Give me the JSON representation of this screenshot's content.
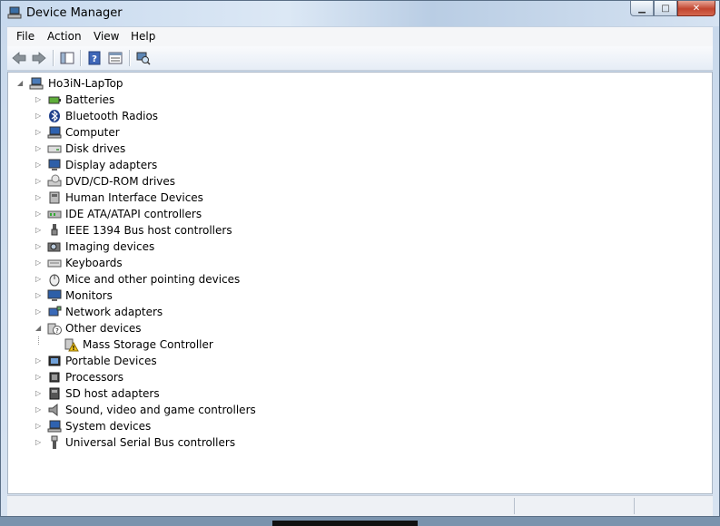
{
  "window": {
    "title": "Device Manager"
  },
  "menu": [
    "File",
    "Action",
    "View",
    "Help"
  ],
  "toolbar": {
    "buttons": [
      "back-icon",
      "forward-icon",
      "show-hide-tree-icon",
      "help-icon",
      "properties-icon",
      "scan-hardware-icon"
    ]
  },
  "tree": {
    "root": {
      "label": "Ho3iN-LapTop",
      "icon": "computer-root-icon"
    },
    "categories": [
      {
        "label": "Batteries",
        "icon": "battery-icon"
      },
      {
        "label": "Bluetooth Radios",
        "icon": "bluetooth-icon"
      },
      {
        "label": "Computer",
        "icon": "computer-icon"
      },
      {
        "label": "Disk drives",
        "icon": "disk-drive-icon"
      },
      {
        "label": "Display adapters",
        "icon": "display-adapter-icon"
      },
      {
        "label": "DVD/CD-ROM drives",
        "icon": "dvd-drive-icon"
      },
      {
        "label": "Human Interface Devices",
        "icon": "hid-icon"
      },
      {
        "label": "IDE ATA/ATAPI controllers",
        "icon": "ide-controller-icon"
      },
      {
        "label": "IEEE 1394 Bus host controllers",
        "icon": "ieee1394-icon"
      },
      {
        "label": "Imaging devices",
        "icon": "camera-icon"
      },
      {
        "label": "Keyboards",
        "icon": "keyboard-icon"
      },
      {
        "label": "Mice and other pointing devices",
        "icon": "mouse-icon"
      },
      {
        "label": "Monitors",
        "icon": "monitor-icon"
      },
      {
        "label": "Network adapters",
        "icon": "network-adapter-icon"
      },
      {
        "label": "Other devices",
        "icon": "unknown-device-icon",
        "expanded": true,
        "children": [
          {
            "label": "Mass Storage Controller",
            "icon": "warning-device-icon"
          }
        ]
      },
      {
        "label": "Portable Devices",
        "icon": "portable-device-icon"
      },
      {
        "label": "Processors",
        "icon": "processor-icon"
      },
      {
        "label": "SD host adapters",
        "icon": "sd-adapter-icon"
      },
      {
        "label": "Sound, video and game controllers",
        "icon": "speaker-icon"
      },
      {
        "label": "System devices",
        "icon": "system-device-icon"
      },
      {
        "label": "Universal Serial Bus controllers",
        "icon": "usb-icon"
      }
    ]
  }
}
